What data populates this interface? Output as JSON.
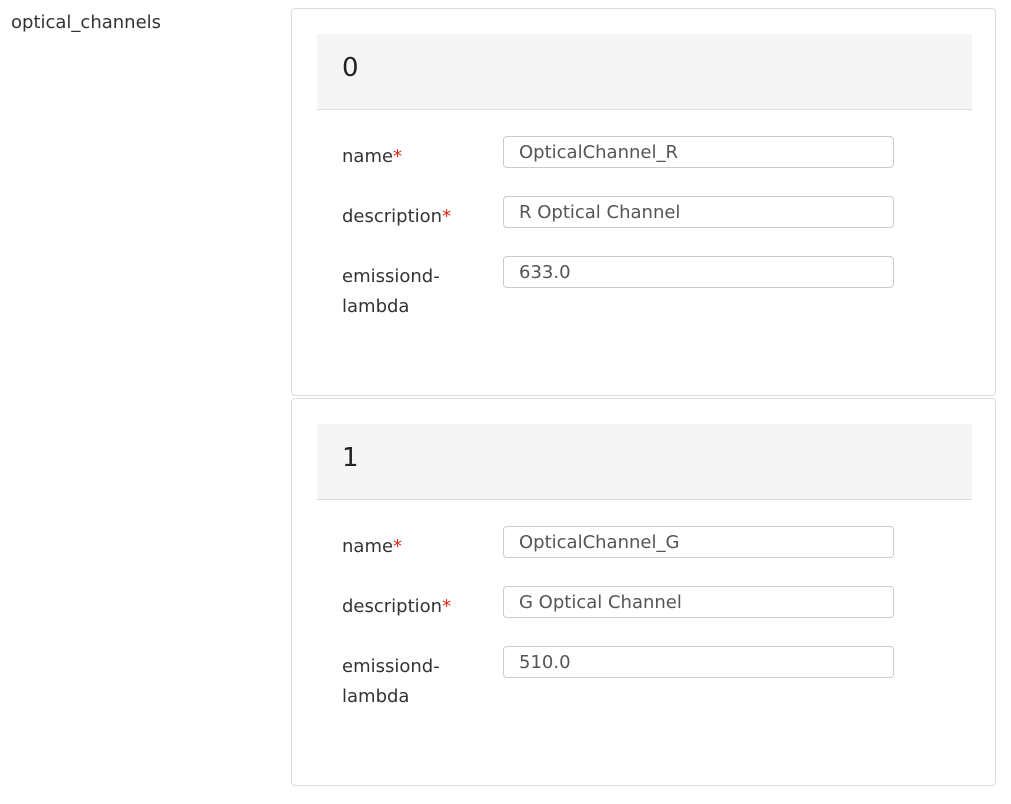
{
  "section": {
    "label": "optical_channels"
  },
  "channels": [
    {
      "index": "0",
      "name_label": "name",
      "name_value": "OpticalChannel_R",
      "description_label": "description",
      "description_value": "R Optical Channel",
      "emission_label_1": "emissiond-",
      "emission_label_2": "lambda",
      "emission_value": "633.0"
    },
    {
      "index": "1",
      "name_label": "name",
      "name_value": "OpticalChannel_G",
      "description_label": "description",
      "description_value": "G Optical Channel",
      "emission_label_1": "emissiond-",
      "emission_label_2": "lambda",
      "emission_value": "510.0"
    }
  ],
  "required_marker": "*",
  "colors": {
    "required": "#d9230f",
    "header_bg": "#f5f5f5",
    "border": "#dcdcdc"
  }
}
